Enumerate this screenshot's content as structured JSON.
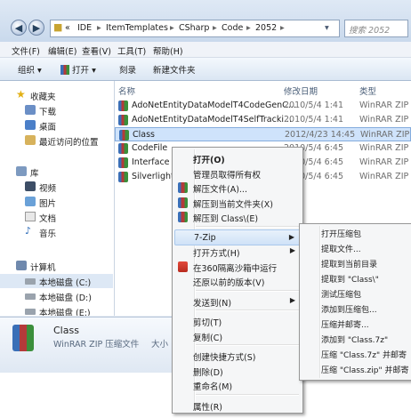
{
  "address": {
    "back_icon": "back-arrow-icon",
    "crumbs": [
      "«",
      "IDE",
      "ItemTemplates",
      "CSharp",
      "Code",
      "2052"
    ],
    "search_placeholder": "搜索 2052"
  },
  "menubar": [
    "文件(F)",
    "编辑(E)",
    "查看(V)",
    "工具(T)",
    "帮助(H)"
  ],
  "toolbar": {
    "organize": "组织",
    "open": "打开",
    "burn": "刻录",
    "new_folder": "新建文件夹"
  },
  "nav": {
    "favorites": "收藏夹",
    "favorites_items": [
      "下载",
      "桌面",
      "最近访问的位置"
    ],
    "libraries": "库",
    "library_items": [
      "视频",
      "图片",
      "文档",
      "音乐"
    ],
    "computer": "计算机",
    "drives": [
      "本地磁盘 (C:)",
      "本地磁盘 (D:)",
      "本地磁盘 (E:)"
    ]
  },
  "columns": {
    "name": "名称",
    "date": "修改日期",
    "type": "类型"
  },
  "files": [
    {
      "name": "AdoNetEntityDataModelT4CodeGenC...",
      "date": "2010/5/4 1:41",
      "type": "WinRAR ZIP",
      "selected": false
    },
    {
      "name": "AdoNetEntityDataModelT4SelfTracki...",
      "date": "2010/5/4 1:41",
      "type": "WinRAR ZIP",
      "selected": false
    },
    {
      "name": "Class",
      "date": "2012/4/23 14:45",
      "type": "WinRAR ZIP",
      "selected": true
    },
    {
      "name": "CodeFile",
      "date": "2010/5/4 6:45",
      "type": "WinRAR ZIP",
      "selected": false
    },
    {
      "name": "Interface",
      "date": "2010/5/4 6:45",
      "type": "WinRAR ZIP",
      "selected": false
    },
    {
      "name": "SilverlightC",
      "date": "2010/5/4 6:45",
      "type": "WinRAR ZIP",
      "selected": false
    }
  ],
  "details": {
    "name": "Class",
    "type": "WinRAR ZIP 压缩文件",
    "size_label": "大小"
  },
  "context_menu": [
    {
      "label": "打开(O)",
      "bold": true
    },
    {
      "label": "管理员取得所有权"
    },
    {
      "label": "解压文件(A)...",
      "icon": "winrar-icon"
    },
    {
      "label": "解压到当前文件夹(X)",
      "icon": "winrar-icon"
    },
    {
      "label": "解压到 Class\\(E)",
      "icon": "winrar-icon"
    },
    {
      "sep": true
    },
    {
      "label": "7-Zip",
      "submenu": true,
      "highlight": true
    },
    {
      "label": "打开方式(H)",
      "submenu": true
    },
    {
      "label": "在360隔离沙箱中运行",
      "icon": "360-sandbox-icon"
    },
    {
      "label": "还原以前的版本(V)"
    },
    {
      "sep": true
    },
    {
      "label": "发送到(N)",
      "submenu": true
    },
    {
      "sep": true
    },
    {
      "label": "剪切(T)"
    },
    {
      "label": "复制(C)"
    },
    {
      "sep": true
    },
    {
      "label": "创建快捷方式(S)"
    },
    {
      "label": "删除(D)"
    },
    {
      "label": "重命名(M)"
    },
    {
      "sep": true
    },
    {
      "label": "属性(R)"
    }
  ],
  "submenu_7zip": [
    "打开压缩包",
    "提取文件...",
    "提取到当前目录",
    "提取到 \"Class\\\"",
    "测试压缩包",
    "添加到压缩包...",
    "压缩并邮寄...",
    "添加到 \"Class.7z\"",
    "压缩 \"Class.7z\" 并邮寄",
    "压缩 \"Class.zip\" 并邮寄"
  ],
  "colors": {
    "selection": "#cfe3fb",
    "menu_bg": "#f5f6f7",
    "window_frame": "#c9d9ec"
  }
}
